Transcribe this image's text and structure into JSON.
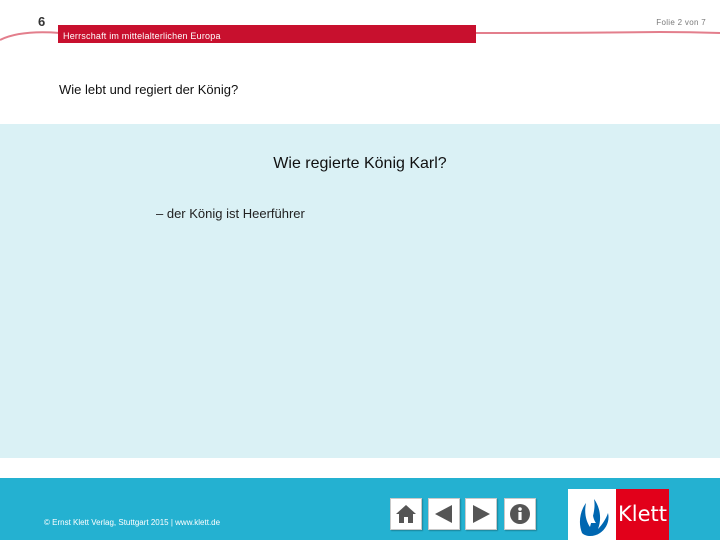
{
  "header": {
    "chapter_number": "6",
    "slide_counter": "Folie 2 von 7",
    "chapter_title": "Herrschaft im mittelalterlichen Europa"
  },
  "question": "Wie lebt und regiert der König?",
  "content": {
    "title": "Wie regierte König Karl?",
    "bullets": [
      "– der König ist Heerführer"
    ]
  },
  "footer": {
    "copyright": "© Ernst Klett Verlag, Stuttgart 2015 | www.klett.de",
    "nav": {
      "home_icon": "home-icon",
      "prev_icon": "arrow-left-icon",
      "next_icon": "arrow-right-icon",
      "info_icon": "info-icon"
    },
    "logo_text": "Klett"
  },
  "colors": {
    "brand_red": "#c8102e",
    "content_bg": "#daf1f5",
    "footer_bg": "#24b1d1",
    "icon_gray": "#555555",
    "logo_blue": "#0067b1"
  }
}
